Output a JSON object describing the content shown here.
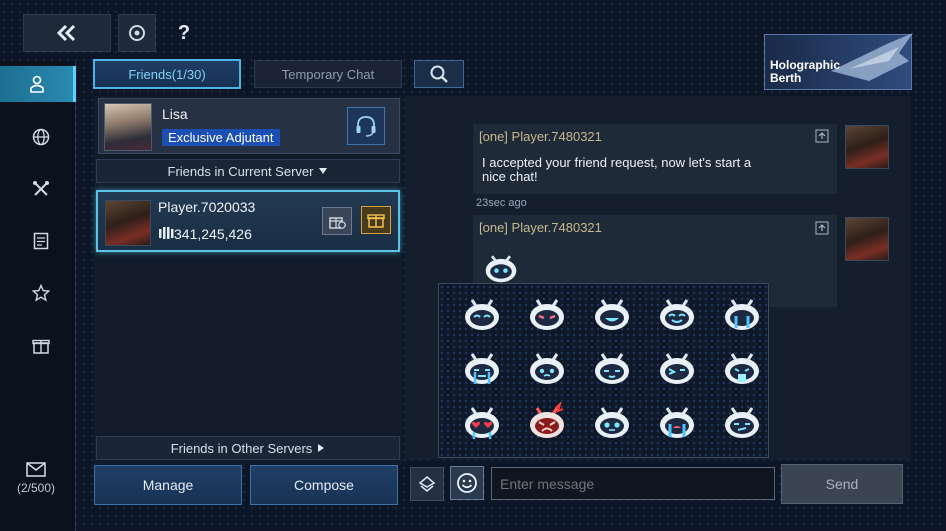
{
  "header": {
    "back_icon": "double-chevron-left-icon",
    "target_icon": "target-icon",
    "help": "?"
  },
  "holo": {
    "label_line1": "Holographic",
    "label_line2": "Berth"
  },
  "sidebar": {
    "items": [
      {
        "name": "friends",
        "icon": "person-icon"
      },
      {
        "name": "world",
        "icon": "globe-icon"
      },
      {
        "name": "alliance",
        "icon": "crossed-tools-icon"
      },
      {
        "name": "notes",
        "icon": "document-icon"
      },
      {
        "name": "favorites",
        "icon": "star-icon"
      },
      {
        "name": "gifts",
        "icon": "gift-icon"
      }
    ],
    "mail_count": "(2/500)"
  },
  "tabs": {
    "friends": "Friends(1/30)",
    "temporary": "Temporary Chat"
  },
  "adjutant": {
    "name": "Lisa",
    "role": "Exclusive Adjutant"
  },
  "groups": {
    "current": "Friends in Current Server",
    "other": "Friends in Other Servers"
  },
  "friend": {
    "name": "Player.7020033",
    "power": "341,245,426"
  },
  "buttons": {
    "manage": "Manage",
    "compose": "Compose",
    "send": "Send"
  },
  "chat": {
    "messages": [
      {
        "sender": "[one] Player.7480321",
        "text_line1": "I accepted your friend request, now let's start a",
        "text_line2": "nice chat!",
        "time": "23sec ago"
      },
      {
        "sender": "[one] Player.7480321"
      }
    ]
  },
  "input": {
    "placeholder": "Enter message"
  },
  "colors": {
    "accent": "#3fb7e0",
    "badge": "#1b4fb4",
    "panel": "#121c2b"
  }
}
